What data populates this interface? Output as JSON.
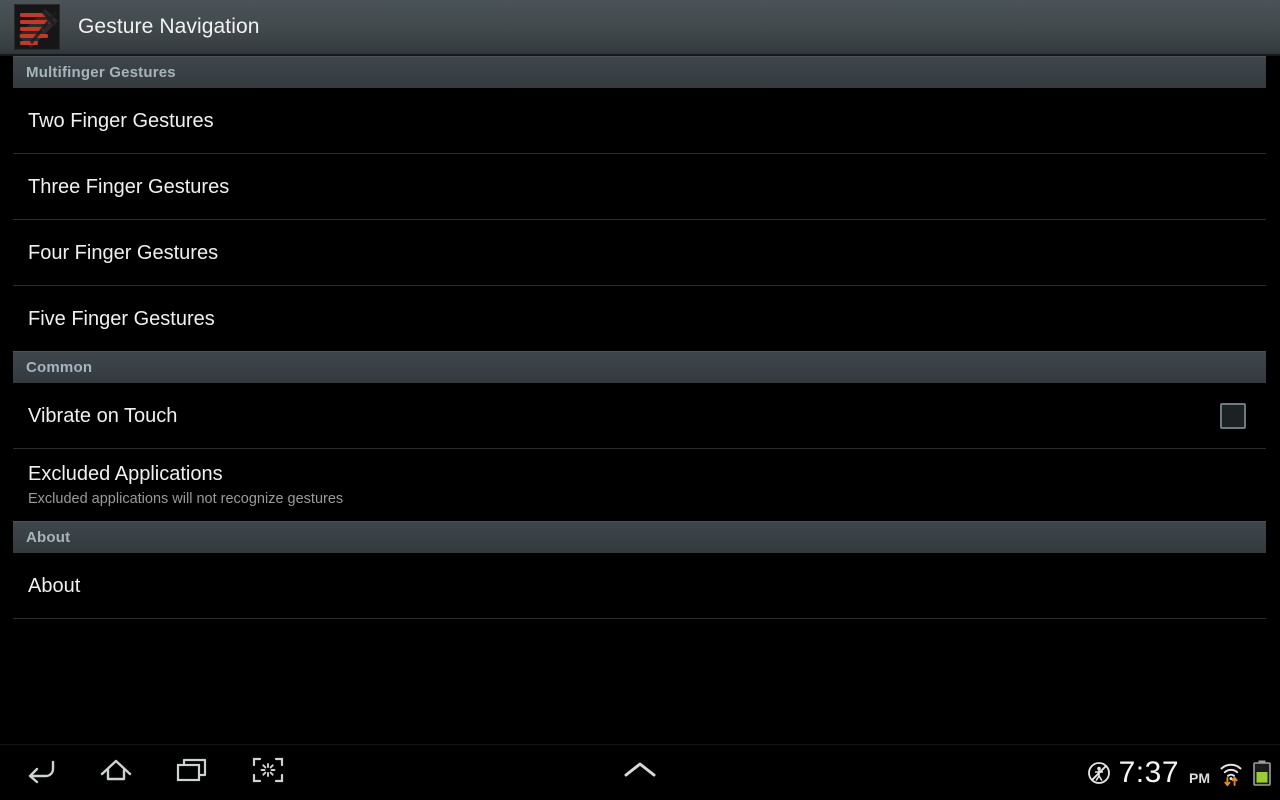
{
  "titlebar": {
    "app_title": "Gesture Navigation",
    "app_icon": "gesture-navigation-app-icon"
  },
  "sections": [
    {
      "header": "Multifinger Gestures",
      "rows": [
        {
          "title": "Two Finger Gestures",
          "summary": "",
          "widget": "none",
          "divider_after": true
        },
        {
          "title": "Three Finger Gestures",
          "summary": "",
          "widget": "none",
          "divider_after": true
        },
        {
          "title": "Four Finger Gestures",
          "summary": "",
          "widget": "none",
          "divider_after": true
        },
        {
          "title": "Five Finger Gestures",
          "summary": "",
          "widget": "none",
          "divider_after": false
        }
      ]
    },
    {
      "header": "Common",
      "rows": [
        {
          "title": "Vibrate on Touch",
          "summary": "",
          "widget": "checkbox",
          "checked": false,
          "divider_after": true
        },
        {
          "title": "Excluded Applications",
          "summary": "Excluded applications will not recognize gestures",
          "widget": "none",
          "divider_after": false
        }
      ]
    },
    {
      "header": "About",
      "rows": [
        {
          "title": "About",
          "summary": "",
          "widget": "none",
          "divider_after": true
        }
      ]
    }
  ],
  "navbar": {
    "back_label": "Back",
    "home_label": "Home",
    "recents_label": "Recent apps",
    "screenshot_label": "Screenshot",
    "drawer_label": "Notifications",
    "status": {
      "time": "7:37",
      "ampm": "PM",
      "mute_icon": "no-person-icon",
      "wifi_icon": "wifi-icon",
      "battery_icon": "battery-icon"
    }
  },
  "colors": {
    "background": "#000000",
    "titlebar_top": "#4a5357",
    "titlebar_bottom": "#2f3639",
    "header_bg": "#394045",
    "header_text": "#a6b4bd",
    "row_text": "#f0f0f0",
    "summary_text": "#9a9a9a",
    "divider": "#2c2c2c",
    "accent_red": "#c0392b",
    "battery_green": "#9acd32",
    "data_arrow_orange": "#e08a2e"
  }
}
